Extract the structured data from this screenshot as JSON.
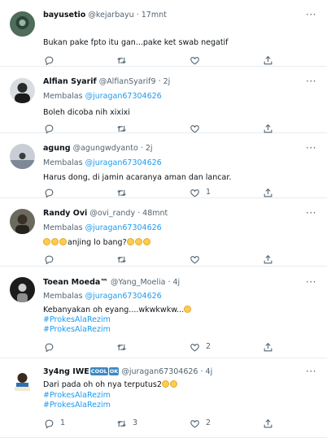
{
  "replying_to_label": "Membalas",
  "replying_to_handle": "@juragan67304626",
  "tweets": [
    {
      "display_name": "bayusetio",
      "handle": "@kejarbayu",
      "time": "17mnt",
      "text": "Bukan pake fpto itu gan...pake ket swab negatif",
      "replies": "",
      "retweets": "",
      "likes": ""
    },
    {
      "display_name": "Alfian Syarif",
      "handle": "@AlfianSyarif9",
      "time": "2j",
      "text": "Boleh dicoba nih xixixi",
      "replies": "",
      "retweets": "",
      "likes": ""
    },
    {
      "display_name": "agung",
      "handle": "@agungwdyanto",
      "time": "2j",
      "text": "Harus dong, di jamin acaranya aman dan lancar.",
      "replies": "",
      "retweets": "",
      "likes": "1"
    },
    {
      "display_name": "Randy Ovi",
      "handle": "@ovi_randy",
      "time": "48mnt",
      "text_before": "",
      "text_mid": "anjing lo bang?",
      "replies": "",
      "retweets": "",
      "likes": ""
    },
    {
      "display_name": "Toean Moeda™",
      "handle": "@Yang_Moelia",
      "time": "4j",
      "text": "Kebanyakan oh eyang....wkwkwkw...",
      "hashtags": [
        "#ProkesAlaRezim",
        "#ProkesAlaRezim"
      ],
      "replies": "",
      "retweets": "",
      "likes": "2"
    },
    {
      "display_name": "3y4ng IWE",
      "badge_1": "COOL",
      "badge_2": "OK",
      "handle": "@juragan67304626",
      "time": "4j",
      "text": "Dari pada oh oh nya terputus2",
      "hashtags": [
        "#ProkesAlaRezim",
        "#ProkesAlaRezim"
      ],
      "replies": "1",
      "retweets": "3",
      "likes": "2"
    }
  ],
  "icons": {
    "reply": "reply-icon",
    "retweet": "retweet-icon",
    "like": "heart-icon",
    "share": "share-icon",
    "more": "more-icon"
  },
  "colors": {
    "link": "#1d9bf0",
    "muted": "#536471",
    "divider": "#e6ecf0"
  }
}
